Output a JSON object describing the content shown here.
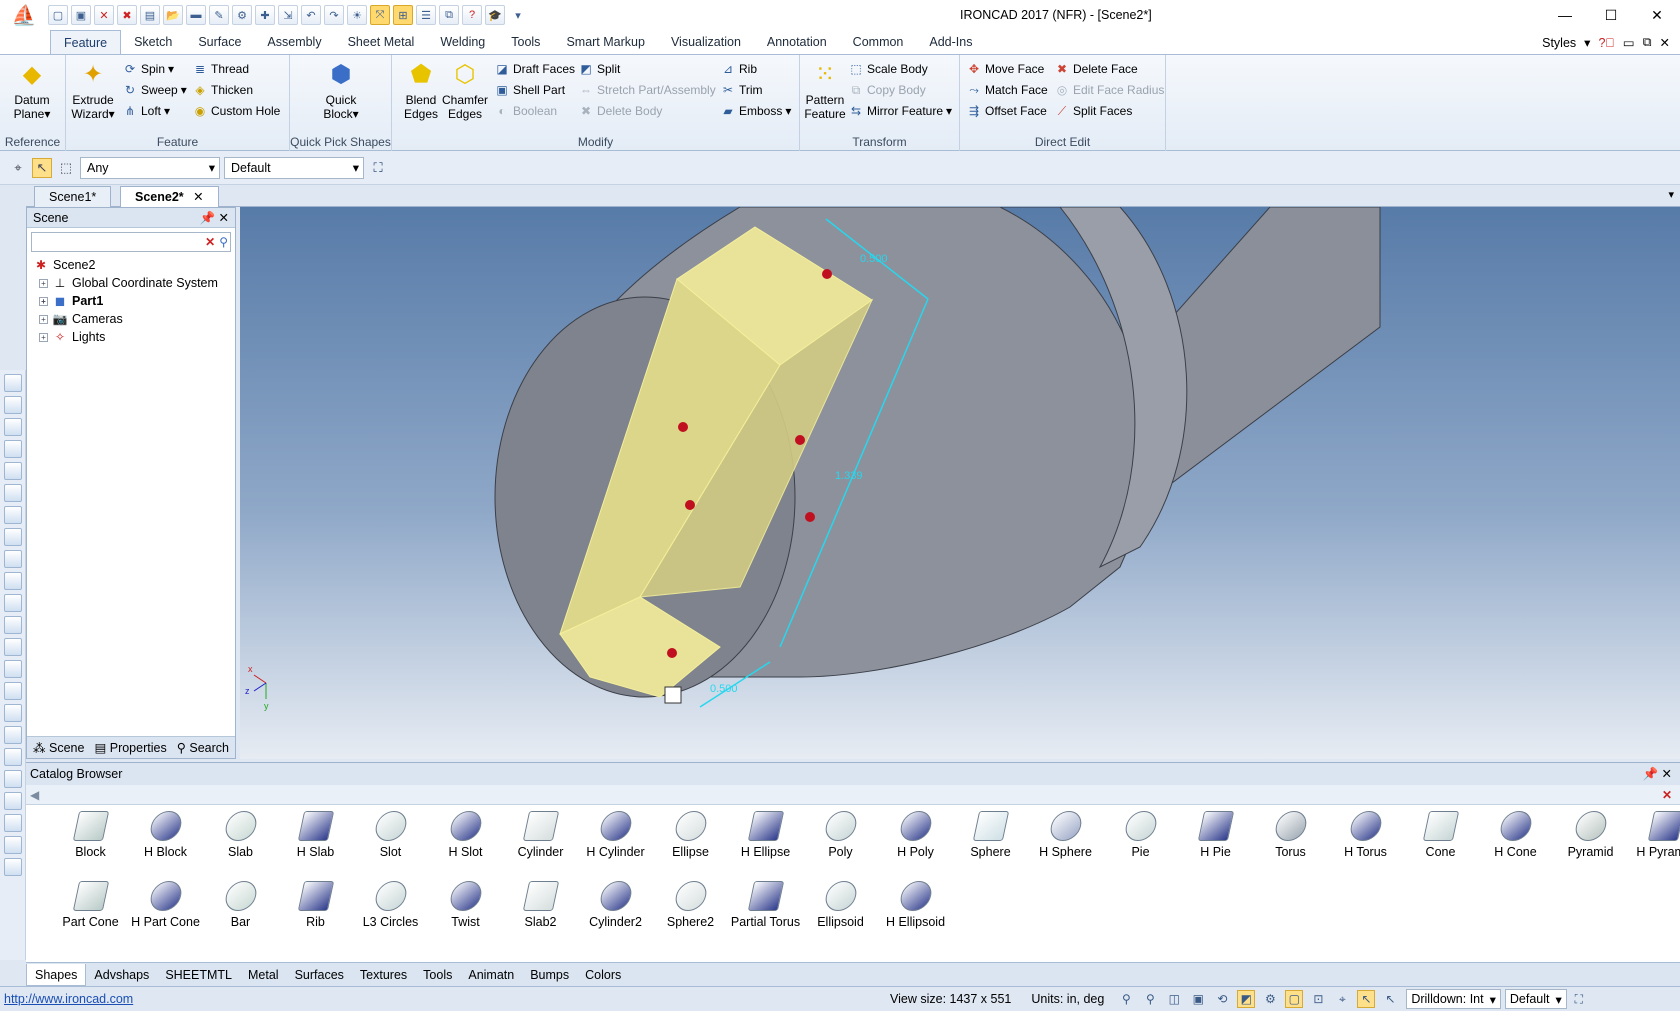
{
  "window": {
    "title": "IRONCAD 2017 (NFR) - [Scene2*]",
    "minimize": "—",
    "maximize": "☐",
    "close": "✕"
  },
  "ribbon_tabs": [
    "Feature",
    "Sketch",
    "Surface",
    "Assembly",
    "Sheet Metal",
    "Welding",
    "Tools",
    "Smart Markup",
    "Visualization",
    "Annotation",
    "Common",
    "Add-Ins"
  ],
  "styles_label": "Styles",
  "ribbon": {
    "reference": {
      "label": "Reference",
      "datum_plane": "Datum Plane"
    },
    "feature": {
      "label": "Feature",
      "extrude_wizard": "Extrude Wizard",
      "spin": "Spin",
      "sweep": "Sweep",
      "loft": "Loft",
      "thread": "Thread",
      "thicken": "Thicken",
      "custom_hole": "Custom Hole"
    },
    "quick_pick": {
      "label": "Quick Pick Shapes",
      "quick_block": "Quick Block"
    },
    "modify": {
      "label": "Modify",
      "blend_edges": "Blend Edges",
      "chamfer_edges": "Chamfer Edges",
      "draft_faces": "Draft Faces",
      "shell_part": "Shell Part",
      "boolean": "Boolean",
      "split": "Split",
      "stretch": "Stretch Part/Assembly",
      "delete_body": "Delete Body",
      "rib": "Rib",
      "trim": "Trim",
      "emboss": "Emboss"
    },
    "transform": {
      "label": "Transform",
      "pattern_feature": "Pattern Feature",
      "scale_body": "Scale Body",
      "copy_body": "Copy Body",
      "mirror_feature": "Mirror Feature"
    },
    "direct_edit": {
      "label": "Direct Edit",
      "move_face": "Move Face",
      "match_face": "Match Face",
      "offset_face": "Offset Face",
      "delete_face": "Delete Face",
      "edit_face_radius": "Edit Face Radius",
      "split_faces": "Split Faces"
    }
  },
  "selection": {
    "filter": "Any",
    "style": "Default"
  },
  "doc_tabs": [
    "Scene1*",
    "Scene2*"
  ],
  "scene_panel": {
    "title": "Scene",
    "tree": [
      {
        "label": "Scene2",
        "bold": false
      },
      {
        "label": "Global Coordinate System",
        "bold": false
      },
      {
        "label": "Part1",
        "bold": true
      },
      {
        "label": "Cameras",
        "bold": false
      },
      {
        "label": "Lights",
        "bold": false
      }
    ],
    "tabs": [
      "Scene",
      "Properties",
      "Search"
    ]
  },
  "viewport": {
    "dimensions": [
      "0.500",
      "1.339",
      "0.500"
    ],
    "triad": {
      "x": "x",
      "y": "y",
      "z": "z"
    }
  },
  "catalog": {
    "title": "Catalog Browser",
    "row1": [
      "Block",
      "H Block",
      "Slab",
      "H Slab",
      "Slot",
      "H Slot",
      "Cylinder",
      "H Cylinder",
      "Ellipse",
      "H Ellipse",
      "Poly",
      "H Poly",
      "Sphere",
      "H Sphere",
      "Pie",
      "H Pie",
      "Torus",
      "H Torus",
      "Cone",
      "H Cone",
      "Pyramid",
      "H Pyramid"
    ],
    "row2": [
      "Part Cone",
      "H Part Cone",
      "Bar",
      "Rib",
      "L3 Circles",
      "Twist",
      "Slab2",
      "Cylinder2",
      "Sphere2",
      "Partial Torus",
      "Ellipsoid",
      "H Ellipsoid"
    ],
    "tabs": [
      "Shapes",
      "Advshaps",
      "SHEETMTL",
      "Metal",
      "Surfaces",
      "Textures",
      "Tools",
      "Animatn",
      "Bumps",
      "Colors"
    ]
  },
  "status": {
    "url": "http://www.ironcad.com",
    "view_size": "View size: 1437 x  551",
    "units": "Units: in, deg",
    "drilldown": "Drilldown: Int",
    "style": "Default"
  }
}
